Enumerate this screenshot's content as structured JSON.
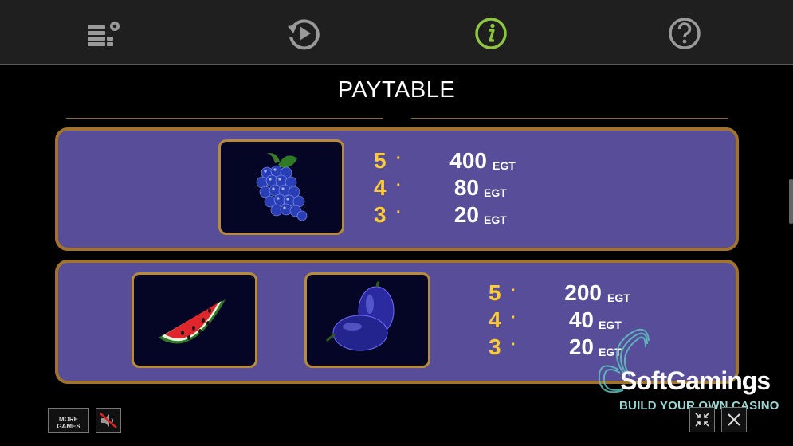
{
  "toolbar": {
    "icons": [
      "settings-stack-icon",
      "replay-icon",
      "info-icon",
      "help-icon"
    ],
    "active_color": "#8dc63f"
  },
  "title": "PAYTABLE",
  "paytable": [
    {
      "symbols": [
        "grapes"
      ],
      "rows": [
        {
          "count": "5",
          "amount": "400",
          "currency": "EGT"
        },
        {
          "count": "4",
          "amount": "80",
          "currency": "EGT"
        },
        {
          "count": "3",
          "amount": "20",
          "currency": "EGT"
        }
      ]
    },
    {
      "symbols": [
        "watermelon",
        "plums"
      ],
      "rows": [
        {
          "count": "5",
          "amount": "200",
          "currency": "EGT"
        },
        {
          "count": "4",
          "amount": "40",
          "currency": "EGT"
        },
        {
          "count": "3",
          "amount": "20",
          "currency": "EGT"
        }
      ]
    }
  ],
  "dot": "·",
  "footer": {
    "more_games_line1": "MORE",
    "more_games_line2": "GAMES"
  },
  "watermark": {
    "name": "SoftGamings",
    "tagline": "BUILD YOUR OWN CASINO"
  },
  "colors": {
    "panel": "#574d98",
    "panel_border": "#a2732f",
    "count": "#ffcc33"
  }
}
